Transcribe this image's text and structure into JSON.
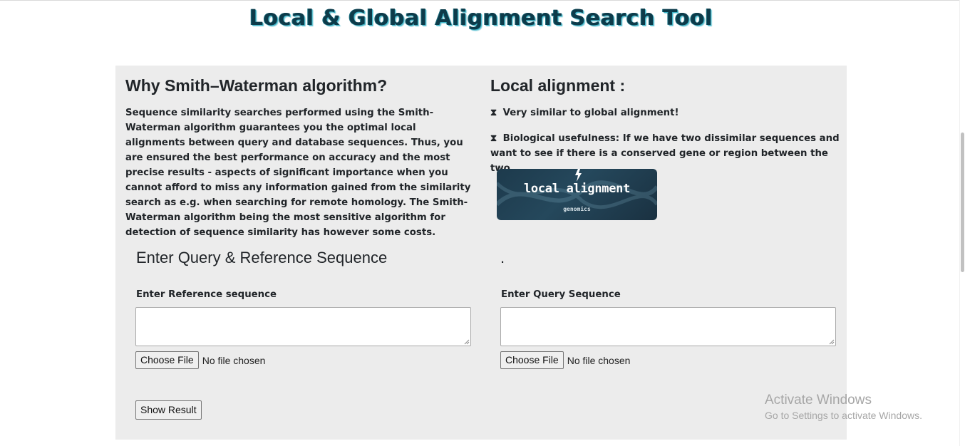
{
  "header": {
    "title": "Local & Global Alignment Search Tool"
  },
  "intro": {
    "left_heading": "Why Smith–Waterman algorithm?",
    "left_text": "Sequence similarity searches performed using the Smith-Waterman algorithm guarantees you the optimal local alignments between query and database sequences. Thus, you are ensured the best performance on accuracy and the most precise results - aspects of significant importance when you cannot afford to miss any information gained from the similarity search as e.g. when searching for remote homology. The Smith-Waterman algorithm being the most sensitive algorithm for detection of sequence similarity has however some costs.",
    "right_heading": "Local alignment :",
    "bullets": [
      {
        "icon": "hourglass-icon",
        "text": "Very similar to global alignment!"
      },
      {
        "icon": "hourglass-icon",
        "text": "Biological usefulness: If we have two dissimilar sequences and want to see if there is a conserved gene or region between the two"
      }
    ],
    "banner": {
      "title": "local alignment",
      "subtitle": "genomics"
    }
  },
  "form": {
    "heading": "Enter Query & Reference Sequence",
    "right_heading": ".",
    "reference_label": "Enter Reference sequence",
    "reference_value": "",
    "query_label": "Enter Query Sequence",
    "query_value": "",
    "choose_file_label": "Choose File",
    "no_file_text": "No file chosen",
    "submit_label": "Show Result"
  },
  "watermark": {
    "title": "Activate Windows",
    "subtitle": "Go to Settings to activate Windows."
  },
  "colors": {
    "panel_bg": "#ececec",
    "title_color": "#0d3b4a",
    "title_accent": "#3fb6c9"
  }
}
